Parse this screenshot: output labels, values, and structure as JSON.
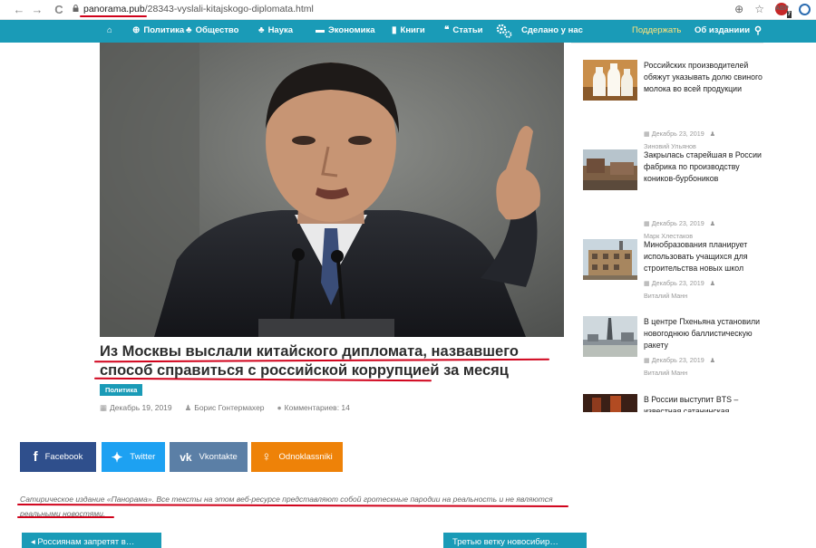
{
  "browser": {
    "url_domain": "panorama.pub",
    "url_path": "/28343-vyslali-kitajskogo-diplomata.html",
    "back_icon": "←",
    "forward_icon": "→",
    "reload_icon": "C",
    "zoom_icon": "⊕",
    "star_icon": "☆",
    "ext_badge_count": "7"
  },
  "nav": {
    "items": [
      {
        "label": "Политика",
        "icon": "globe-icon",
        "glyph": "⊕"
      },
      {
        "label": "Общество",
        "icon": "people-icon",
        "glyph": "♣"
      },
      {
        "label": "Наука",
        "icon": "flask-icon",
        "glyph": "♣"
      },
      {
        "label": "Экономика",
        "icon": "money-icon",
        "glyph": "▬"
      },
      {
        "label": "Книги",
        "icon": "book-icon",
        "glyph": "▮"
      },
      {
        "label": "Статьи",
        "icon": "quote-icon",
        "glyph": "❝"
      },
      {
        "label": "Сделано у нас",
        "icon": "gear-icon",
        "glyph": ""
      }
    ],
    "support": "Поддержать",
    "about": "Об изданиии",
    "home_glyph": "⌂",
    "search_glyph": "⚲"
  },
  "article": {
    "title": "Из Москвы выслали китайского дипломата, назвавшего способ справиться с российской коррупцией за месяц",
    "category": "Политика",
    "date": "Декабрь 19, 2019",
    "author": "Борис Гонтермахер",
    "comments": "Комментариев: 14",
    "date_icon": "▦",
    "author_icon": "♟",
    "comment_icon": "●"
  },
  "share": {
    "facebook": "Facebook",
    "twitter": "Twitter",
    "vkontakte": "Vkontakte",
    "odnoklassniki": "Odnoklassniki",
    "fb_glyph": "f",
    "tw_glyph": "✦",
    "vk_glyph": "vk",
    "ok_glyph": "♀"
  },
  "disclaimer": "Сатирическое издание «Панорама». Все тексты на этом веб-ресурсе представляют собой гротескные пародии на реальность и не являются реальными новостями.",
  "pager": {
    "prev": "◂ Россиянам запретят в…",
    "next": "Третью ветку новосибир…"
  },
  "sidebar": {
    "posts": [
      {
        "title": "Российских производителей обяжут указывать долю свиного молока во всей продукции",
        "date": "Декабрь 23, 2019",
        "author": "Зиновий Ульянов"
      },
      {
        "title": "Закрылась старейшая в России фабрика по производству коников-бурбоников",
        "date": "Декабрь 23, 2019",
        "author": "Марк Хлестаков"
      },
      {
        "title": "Минобразования планирует использовать учащихся для строительства новых школ",
        "date": "Декабрь 23, 2019",
        "author": "Виталий Манн"
      },
      {
        "title": "В центре Пхеньяна установили новогоднюю баллистическую ракету",
        "date": "Декабрь 23, 2019",
        "author": "Виталий Манн"
      },
      {
        "title": "В России выступит BTS – известная сатанинская",
        "date": "",
        "author": ""
      }
    ],
    "date_icon": "▦",
    "author_icon": "♟"
  },
  "colors": {
    "nav_bg": "#1a9bb7",
    "accent_underline": "#d0021b",
    "facebook": "#2f4f8c",
    "twitter": "#1da1f2",
    "vk": "#5b7fa6",
    "ok": "#ee8208"
  }
}
